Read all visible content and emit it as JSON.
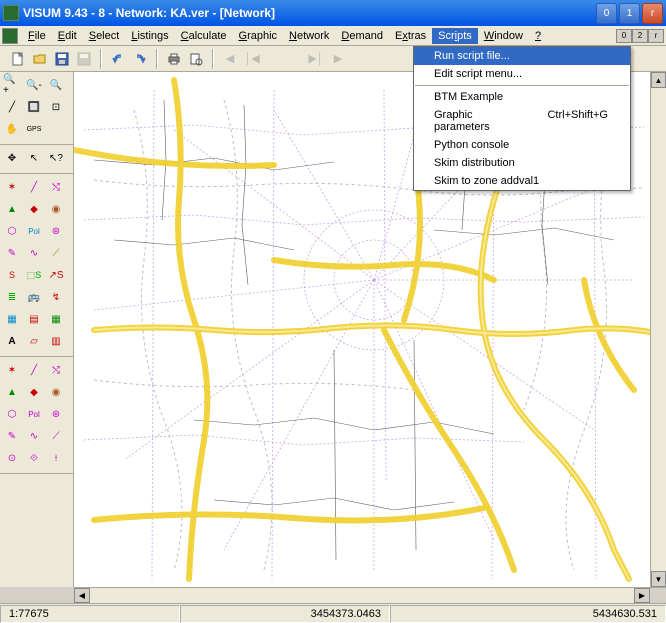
{
  "window": {
    "title": "VISUM 9.43 - 8 - Network: KA.ver - [Network]"
  },
  "menubar": {
    "items": [
      {
        "label": "File",
        "u": 0
      },
      {
        "label": "Edit",
        "u": 0
      },
      {
        "label": "Select",
        "u": 0
      },
      {
        "label": "Listings",
        "u": 0
      },
      {
        "label": "Calculate",
        "u": 0
      },
      {
        "label": "Graphic",
        "u": 0
      },
      {
        "label": "Network",
        "u": 0
      },
      {
        "label": "Demand",
        "u": 0
      },
      {
        "label": "Extras",
        "u": 1
      },
      {
        "label": "Scripts",
        "u": 3
      },
      {
        "label": "Window",
        "u": 0
      },
      {
        "label": "?",
        "u": 0
      }
    ],
    "active": 9
  },
  "scripts_menu": {
    "items": [
      {
        "label": "Run script file...",
        "accel": "",
        "highlight": true
      },
      {
        "label": "Edit script menu...",
        "accel": ""
      },
      {
        "sep": true
      },
      {
        "label": "BTM Example",
        "accel": ""
      },
      {
        "label": "Graphic parameters",
        "accel": "Ctrl+Shift+G"
      },
      {
        "label": "Python console",
        "accel": ""
      },
      {
        "label": "Skim distribution",
        "accel": ""
      },
      {
        "label": "Skim to zone addval1",
        "accel": ""
      }
    ]
  },
  "toolbar": {
    "gps_label": "GPS"
  },
  "statusbar": {
    "scale": "1:77675",
    "x": "3454373.0463",
    "y": "5434630.531"
  }
}
